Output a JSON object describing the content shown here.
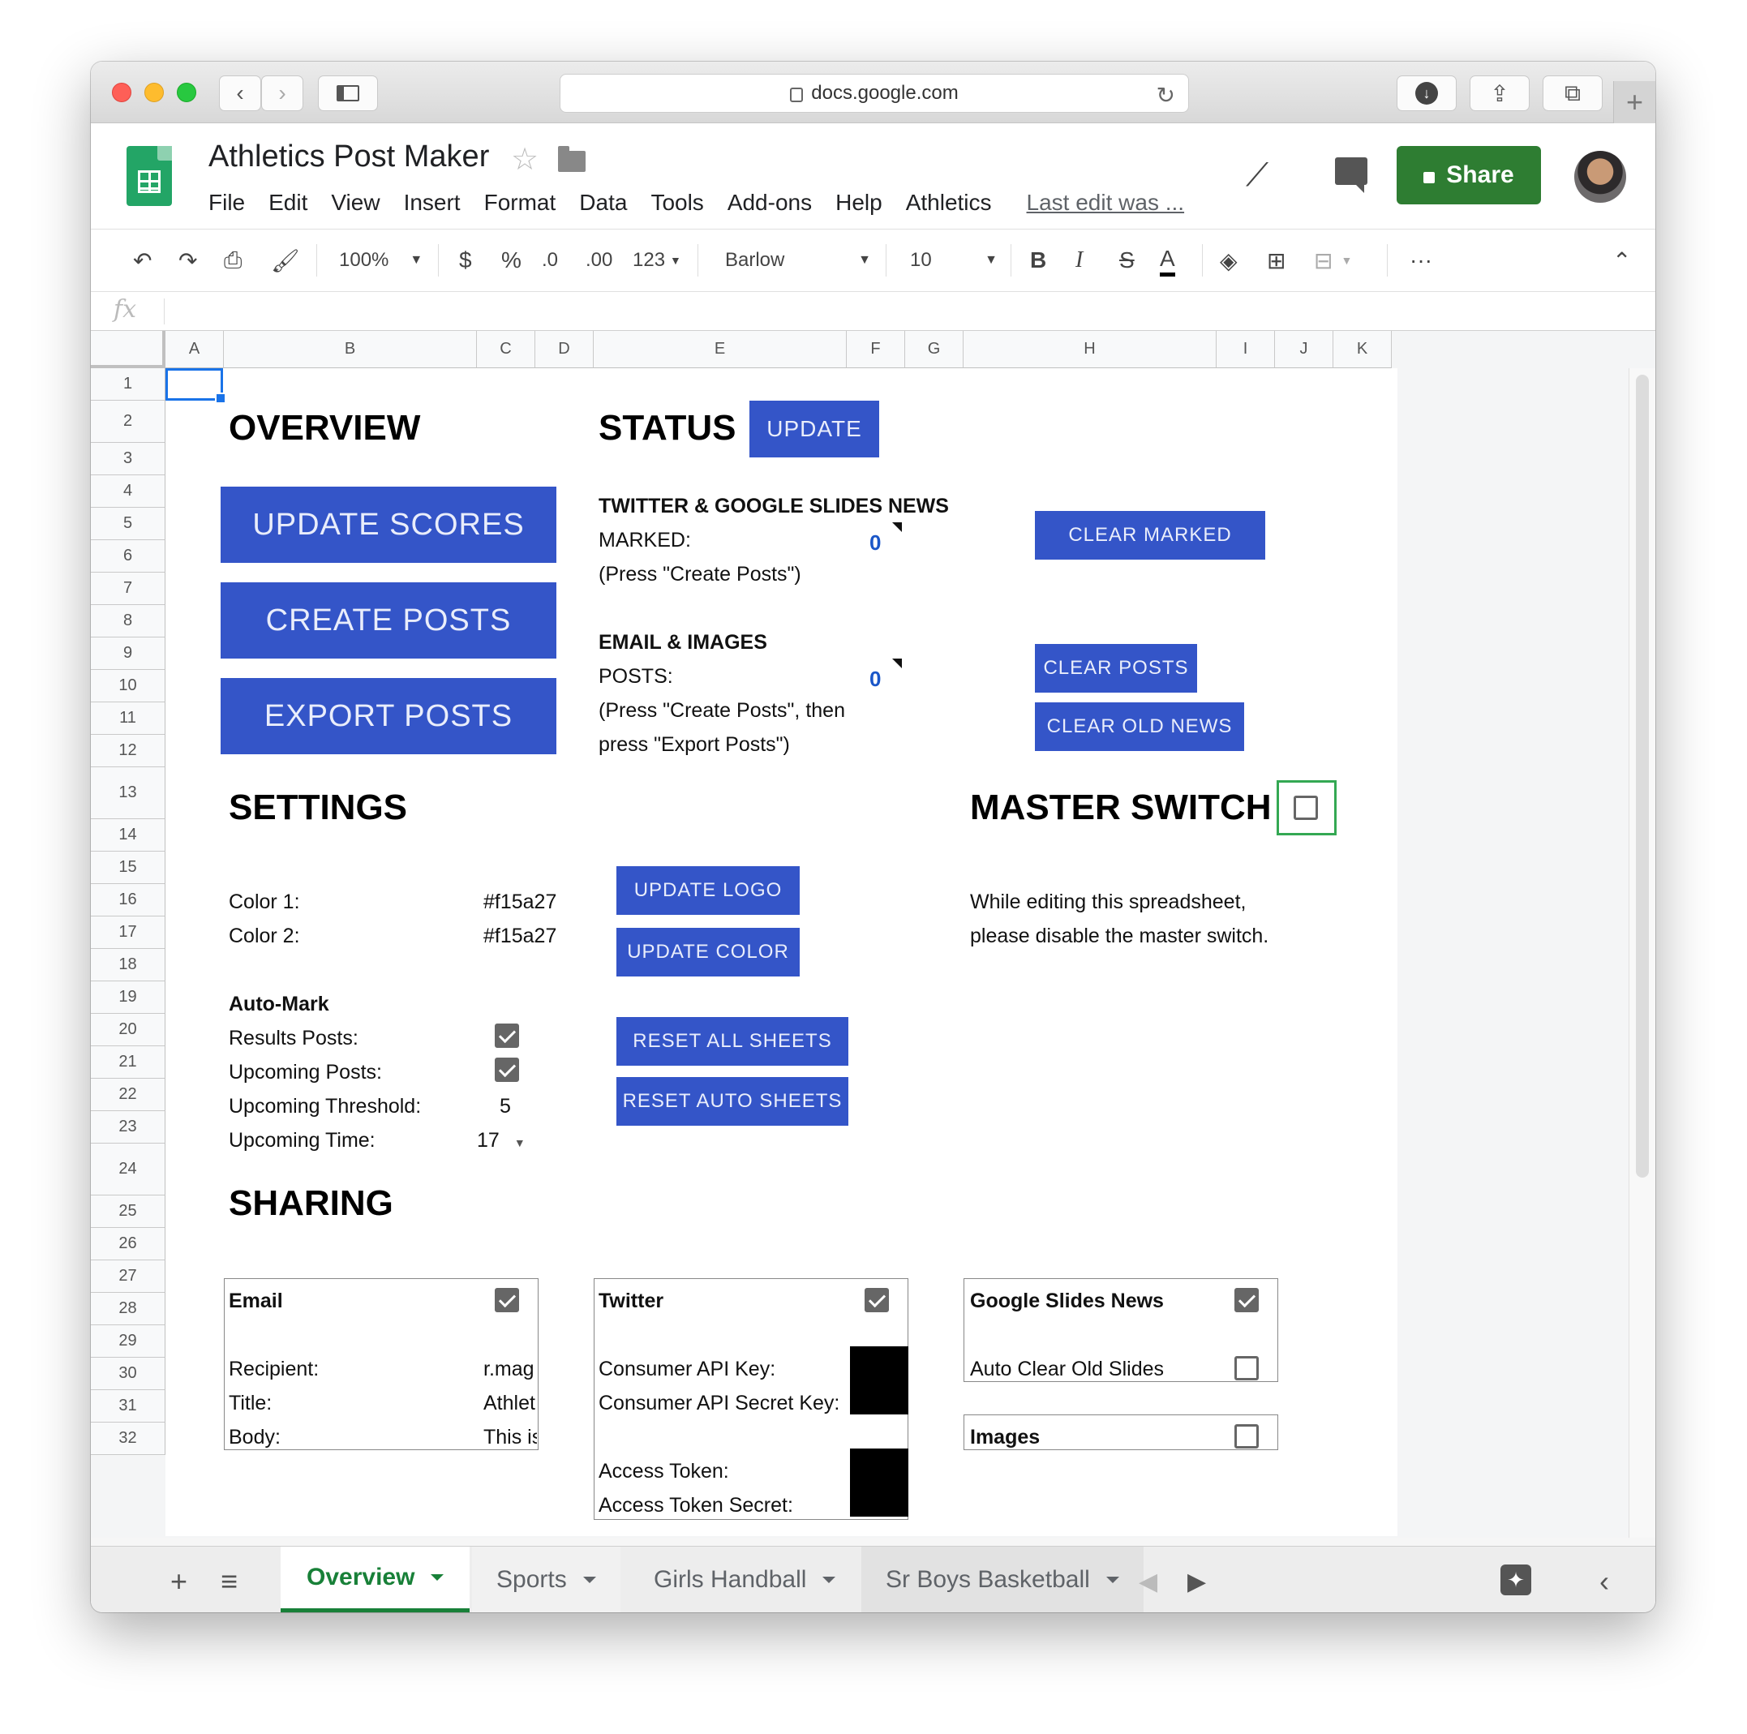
{
  "browser": {
    "url": "docs.google.com"
  },
  "doc": {
    "title": "Athletics Post Maker",
    "menus": [
      "File",
      "Edit",
      "View",
      "Insert",
      "Format",
      "Data",
      "Tools",
      "Add-ons",
      "Help",
      "Athletics"
    ],
    "last_edit": "Last edit was ...",
    "share_label": "Share"
  },
  "toolbar": {
    "zoom": "100%",
    "currency": "$",
    "percent": "%",
    "dec_less": ".0",
    "dec_more": ".00",
    "format_more": "123",
    "font": "Barlow",
    "font_size": "10",
    "bold": "B",
    "italic": "I",
    "strike": "S",
    "text_color": "A",
    "more": "···"
  },
  "formula": {
    "fx": "fx"
  },
  "columns": [
    "A",
    "B",
    "C",
    "D",
    "E",
    "F",
    "G",
    "H",
    "I",
    "J",
    "K"
  ],
  "rows": [
    "1",
    "2",
    "3",
    "4",
    "5",
    "6",
    "7",
    "8",
    "9",
    "10",
    "11",
    "12",
    "13",
    "14",
    "15",
    "16",
    "17",
    "18",
    "19",
    "20",
    "21",
    "22",
    "23",
    "24",
    "25",
    "26",
    "27",
    "28",
    "29",
    "30",
    "31",
    "32"
  ],
  "overview": {
    "heading": "OVERVIEW",
    "update_scores": "UPDATE SCORES",
    "create_posts": "CREATE POSTS",
    "export_posts": "EXPORT POSTS"
  },
  "status": {
    "heading": "STATUS",
    "update": "UPDATE",
    "tw_heading": "TWITTER & GOOGLE SLIDES NEWS",
    "marked_label": "MARKED:",
    "marked_value": "0",
    "marked_hint": "(Press \"Create Posts\")",
    "clear_marked": "CLEAR MARKED",
    "email_heading": "EMAIL & IMAGES",
    "posts_label": "POSTS:",
    "posts_value": "0",
    "posts_hint1": "(Press \"Create Posts\", then",
    "posts_hint2": "press \"Export Posts\")",
    "clear_posts": "CLEAR POSTS",
    "clear_old_news": "CLEAR OLD NEWS"
  },
  "settings": {
    "heading": "SETTINGS",
    "color1_label": "Color 1:",
    "color1_value": "#f15a27",
    "color2_label": "Color 2:",
    "color2_value": "#f15a27",
    "update_logo": "UPDATE LOGO",
    "update_color": "UPDATE COLOR",
    "automark_heading": "Auto-Mark",
    "results_posts": "Results Posts:",
    "results_posts_checked": true,
    "upcoming_posts": "Upcoming Posts:",
    "upcoming_posts_checked": true,
    "upcoming_threshold": "Upcoming Threshold:",
    "upcoming_threshold_value": "5",
    "upcoming_time": "Upcoming Time:",
    "upcoming_time_value": "17",
    "reset_all": "RESET ALL SHEETS",
    "reset_auto": "RESET AUTO SHEETS"
  },
  "master": {
    "heading": "MASTER SWITCH",
    "checked": false,
    "info1": "While editing this spreadsheet,",
    "info2": "please disable the master switch."
  },
  "sharing": {
    "heading": "SHARING",
    "email": {
      "title": "Email",
      "checked": true,
      "recipient_label": "Recipient:",
      "recipient_value": "r.mag",
      "title_label": "Title:",
      "title_value": "Athlet",
      "body_label": "Body:",
      "body_value": "This is"
    },
    "twitter": {
      "title": "Twitter",
      "checked": true,
      "consumer_key": "Consumer API Key:",
      "consumer_secret": "Consumer API Secret Key:",
      "access_token": "Access Token:",
      "access_secret": "Access Token Secret:"
    },
    "slides": {
      "title": "Google Slides News",
      "checked": true,
      "auto_clear": "Auto Clear Old Slides",
      "auto_clear_checked": false
    },
    "images": {
      "title": "Images",
      "checked": false
    }
  },
  "tabs": [
    "Overview",
    "Sports",
    "Girls Handball",
    "Sr Boys Basketball"
  ],
  "colors": {
    "button": "#3455c8",
    "share": "#2e7d32",
    "active_tab": "#188038"
  }
}
